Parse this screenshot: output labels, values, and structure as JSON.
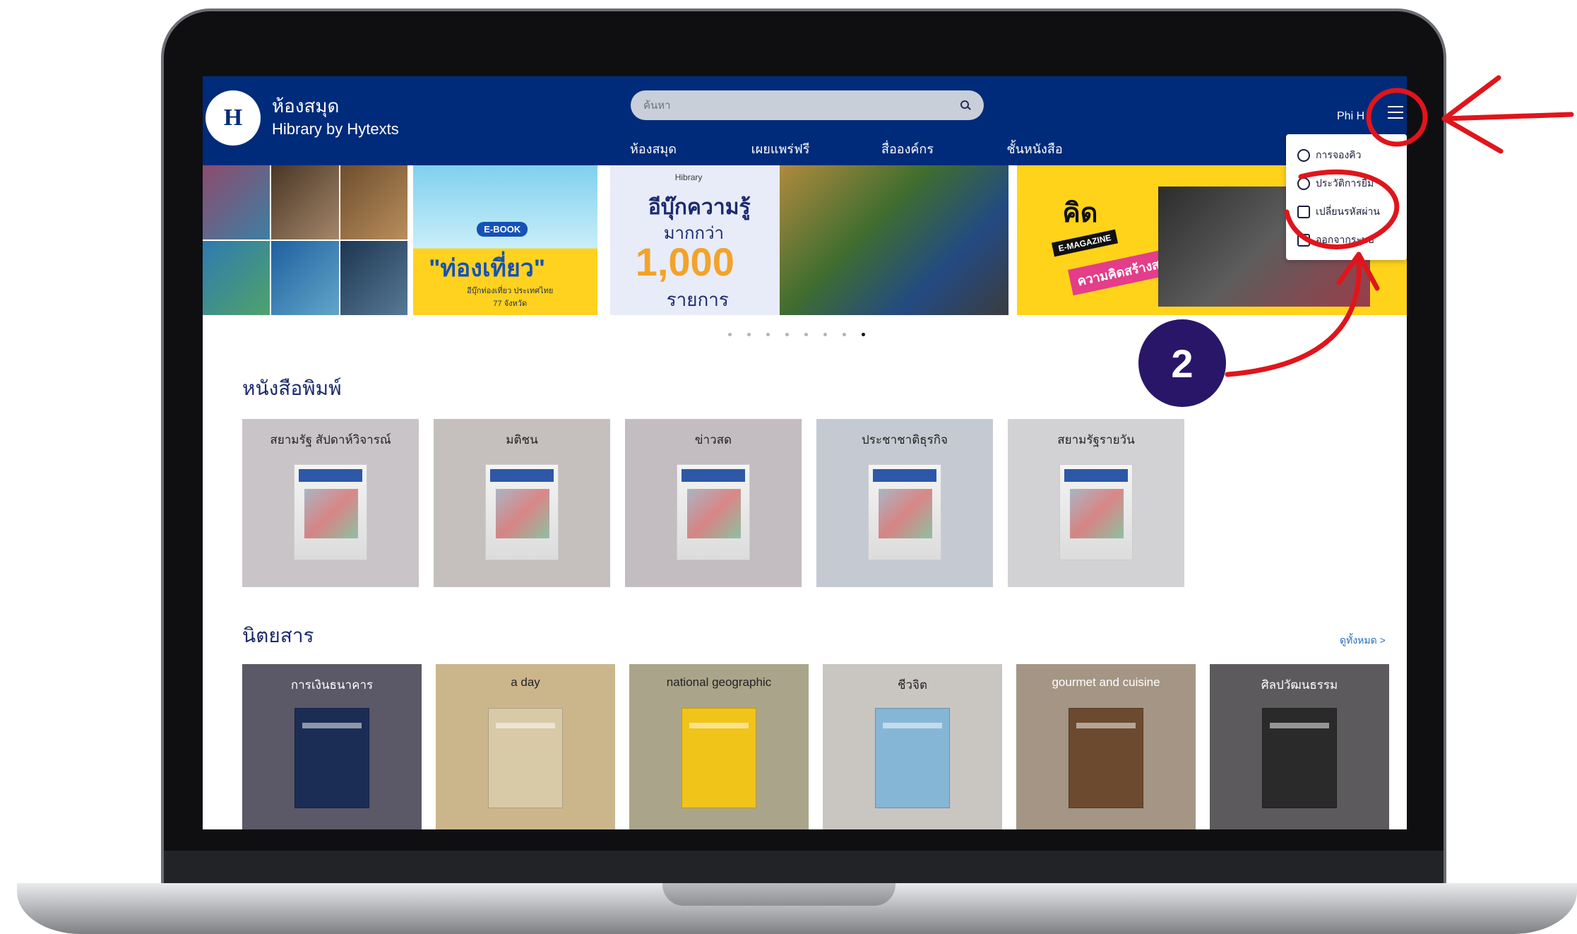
{
  "header": {
    "brand_title": "ห้องสมุด",
    "brand_subtitle": "Hibrary by Hytexts",
    "logo_text": "H",
    "search_placeholder": "ค้นหา",
    "nav": [
      "ห้องสมุด",
      "เผยแพร่ฟรี",
      "สื่อองค์กร",
      "ชั้นหนังสือ"
    ],
    "user_name": "Phi H"
  },
  "dropdown": {
    "items": [
      {
        "label": "การจองคิว",
        "icon": "clock-icon"
      },
      {
        "label": "ประวัติการยืม",
        "icon": "history-icon"
      },
      {
        "label": "เปลี่ยนรหัสผ่าน",
        "icon": "lock-icon"
      },
      {
        "label": "ออกจากระบบ",
        "icon": "logout-icon"
      }
    ]
  },
  "banner": {
    "slide2_badge": "E-BOOK",
    "slide2_title": "\"ท่องเที่ยว\"",
    "slide2_sub": "อีบุ๊กท่องเที่ยว ประเทศไทย 77 จังหวัด",
    "slide3_tag": "Hibrary",
    "slide3_line1": "อีบุ๊กความรู้",
    "slide3_line2": "มากกว่า",
    "slide3_number": "1,000",
    "slide3_line4": "รายการ",
    "slide4_title": "คิด",
    "slide4_mag": "E-MAGAZINE",
    "slide4_pink": "ความคิดสร้างสรรค์",
    "dot_count": 8,
    "active_dot": 8
  },
  "newspapers": {
    "title": "หนังสือพิมพ์",
    "items": [
      "สยามรัฐ สัปดาห์วิจารณ์",
      "มติชน",
      "ข่าวสด",
      "ประชาชาติธุรกิจ",
      "สยามรัฐรายวัน"
    ],
    "tile_colors": [
      "#c9c4c8",
      "#c5c0bd",
      "#c3bcc0",
      "#c5cad2",
      "#d2d2d4"
    ]
  },
  "magazines": {
    "title": "นิตยสาร",
    "see_all": "ดูทั้งหมด >",
    "items": [
      {
        "label": "การเงินธนาคาร",
        "bg": "#5b5868",
        "fg": "#ffffff",
        "cover": "#1b2d55"
      },
      {
        "label": "a day",
        "bg": "#cbb68c",
        "fg": "#222222",
        "cover": "#d8c9a7"
      },
      {
        "label": "national geographic",
        "bg": "#aaa58a",
        "fg": "#222222",
        "cover": "#f0c419"
      },
      {
        "label": "ชีวจิต",
        "bg": "#c9c6c2",
        "fg": "#222222",
        "cover": "#86b6d6"
      },
      {
        "label": "gourmet and cuisine",
        "bg": "#a49585",
        "fg": "#ffffff",
        "cover": "#6b4a30"
      },
      {
        "label": "ศิลปวัฒนธรรม",
        "bg": "#5d5a5d",
        "fg": "#ffffff",
        "cover": "#2a2a2a"
      }
    ]
  },
  "annotation": {
    "step_number": "2",
    "color": "#e0151b"
  }
}
